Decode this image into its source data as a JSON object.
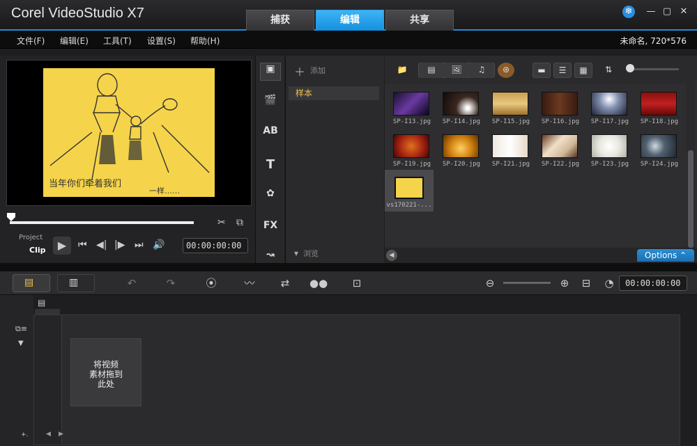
{
  "window": {
    "title": "Corel VideoStudio X7"
  },
  "mode_tabs": [
    {
      "label": "捕获"
    },
    {
      "label": "编辑"
    },
    {
      "label": "共享"
    }
  ],
  "menu": [
    {
      "label": "文件(F)"
    },
    {
      "label": "编辑(E)"
    },
    {
      "label": "工具(T)"
    },
    {
      "label": "设置(S)"
    },
    {
      "label": "帮助(H)"
    }
  ],
  "project_info": "未命名, 720*576",
  "preview": {
    "caption_line1": "当年你们牵着我们",
    "caption_line2": "一样……",
    "mode_project": "Project",
    "mode_clip": "Clip",
    "timecode": "00:00:00:00"
  },
  "library": {
    "add_label": "添加",
    "folder_label": "样本",
    "browse_label": "浏览",
    "options_label": "Options",
    "thumbnails": [
      {
        "name": "SP-I13.jpg"
      },
      {
        "name": "SP-I14.jpg"
      },
      {
        "name": "SP-I15.jpg"
      },
      {
        "name": "SP-I16.jpg"
      },
      {
        "name": "SP-I17.jpg"
      },
      {
        "name": "SP-I18.jpg"
      },
      {
        "name": "SP-I19.jpg"
      },
      {
        "name": "SP-I20.jpg"
      },
      {
        "name": "SP-I21.jpg"
      },
      {
        "name": "SP-I22.jpg"
      },
      {
        "name": "SP-I23.jpg"
      },
      {
        "name": "SP-I24.jpg"
      },
      {
        "name": "vs170221-..."
      }
    ]
  },
  "timeline": {
    "timecode": "00:00:00:00",
    "drop_hint": "将视频素材拖到此处",
    "drop_hint_line1": "将视频",
    "drop_hint_line2": "素材拖到",
    "drop_hint_line3": "此处",
    "footer_label": "+."
  },
  "colors": {
    "accent": "#1f8fd8",
    "folder_text": "#f0c24a",
    "preview_bg": "#f5d34a"
  }
}
